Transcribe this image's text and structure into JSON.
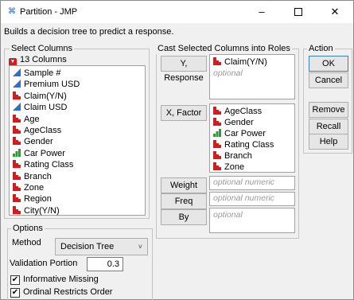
{
  "window": {
    "title": "Partition - JMP",
    "app_icon": "jmp-icon",
    "minimize": "–",
    "close": "✕"
  },
  "description": "Builds a decision tree to predict a response.",
  "select_columns": {
    "label": "Select Columns",
    "count_label": "13 Columns",
    "items": [
      {
        "label": "Sample #",
        "icon": "continuous-icon"
      },
      {
        "label": "Premium USD",
        "icon": "continuous-icon"
      },
      {
        "label": "Claim(Y/N)",
        "icon": "nominal-icon"
      },
      {
        "label": "Claim USD",
        "icon": "continuous-icon"
      },
      {
        "label": "Age",
        "icon": "nominal-icon"
      },
      {
        "label": "AgeClass",
        "icon": "nominal-icon"
      },
      {
        "label": "Gender",
        "icon": "nominal-icon"
      },
      {
        "label": "Car Power",
        "icon": "ordinal-icon"
      },
      {
        "label": "Rating Class",
        "icon": "nominal-icon"
      },
      {
        "label": "Branch",
        "icon": "nominal-icon"
      },
      {
        "label": "Zone",
        "icon": "nominal-icon"
      },
      {
        "label": "Region",
        "icon": "nominal-icon"
      },
      {
        "label": "City(Y/N)",
        "icon": "nominal-icon"
      }
    ]
  },
  "cast": {
    "label": "Cast Selected Columns into Roles",
    "y_button": "Y, Response",
    "y_items": [
      {
        "label": "Claim(Y/N)",
        "icon": "nominal-icon"
      }
    ],
    "y_placeholder": "optional",
    "x_button": "X, Factor",
    "x_items": [
      {
        "label": "AgeClass",
        "icon": "nominal-icon"
      },
      {
        "label": "Gender",
        "icon": "nominal-icon"
      },
      {
        "label": "Car Power",
        "icon": "ordinal-icon"
      },
      {
        "label": "Rating Class",
        "icon": "nominal-icon"
      },
      {
        "label": "Branch",
        "icon": "nominal-icon"
      },
      {
        "label": "Zone",
        "icon": "nominal-icon"
      }
    ],
    "weight_button": "Weight",
    "weight_placeholder": "optional numeric",
    "freq_button": "Freq",
    "freq_placeholder": "optional numeric",
    "by_button": "By",
    "by_placeholder": "optional"
  },
  "action": {
    "label": "Action",
    "ok": "OK",
    "cancel": "Cancel",
    "remove": "Remove",
    "recall": "Recall",
    "help": "Help"
  },
  "options": {
    "label": "Options",
    "method_label": "Method",
    "method_value": "Decision Tree",
    "validation_label": "Validation Portion",
    "validation_value": "0.3",
    "informative_missing_label": "Informative Missing",
    "informative_missing_checked": true,
    "ordinal_restricts_label": "Ordinal Restricts Order",
    "ordinal_restricts_checked": true
  },
  "colors": {
    "continuous": "#2f6fc9",
    "nominal": "#cc1f1f",
    "ordinal": "#2e9a3a"
  }
}
